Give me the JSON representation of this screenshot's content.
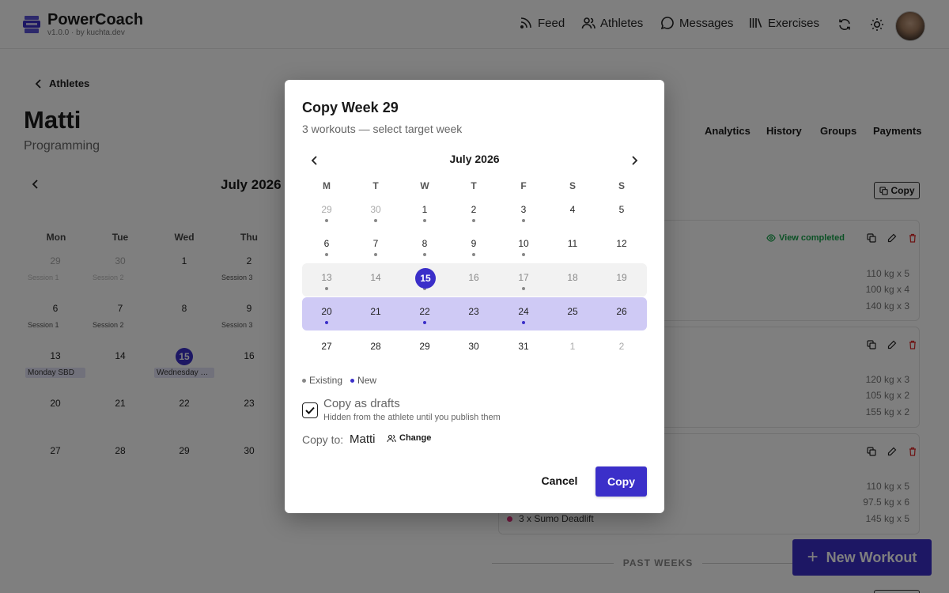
{
  "app": {
    "title": "PowerCoach",
    "version": "v1.0.0 · by kuchta.dev"
  },
  "nav": {
    "feed": "Feed",
    "athletes": "Athletes",
    "messages": "Messages",
    "exercises": "Exercises"
  },
  "page": {
    "back_label": "Athletes",
    "athlete_name": "Matti",
    "section": "Programming",
    "tabs": [
      "Analytics",
      "History",
      "Groups",
      "Payments"
    ],
    "copy_label": "Copy"
  },
  "bg_calendar": {
    "month": "July 2026",
    "weekdays": [
      "Mon",
      "Tue",
      "Wed",
      "Thu"
    ],
    "rows": [
      [
        {
          "d": "29",
          "s": "Session 1",
          "dim": true
        },
        {
          "d": "30",
          "s": "Session 2",
          "dim": true
        },
        {
          "d": "1",
          "s": ""
        },
        {
          "d": "2",
          "s": "Session 3"
        }
      ],
      [
        {
          "d": "6",
          "s": "Session 1"
        },
        {
          "d": "7",
          "s": "Session 2"
        },
        {
          "d": "8",
          "s": ""
        },
        {
          "d": "9",
          "s": "Session 3"
        }
      ],
      [
        {
          "d": "13",
          "chip": "Monday SBD"
        },
        {
          "d": "14",
          "s": ""
        },
        {
          "d": "15",
          "chip": "Wednesday S..."
        },
        {
          "d": "16",
          "s": ""
        }
      ],
      [
        {
          "d": "20",
          "s": ""
        },
        {
          "d": "21",
          "s": ""
        },
        {
          "d": "22",
          "s": ""
        },
        {
          "d": "23",
          "s": ""
        }
      ],
      [
        {
          "d": "27",
          "s": ""
        },
        {
          "d": "28",
          "s": ""
        },
        {
          "d": "29",
          "s": ""
        },
        {
          "d": "30",
          "s": ""
        }
      ]
    ]
  },
  "cards": [
    {
      "view_completed": "View completed",
      "sets": [
        "110 kg x 5",
        "100 kg x 4",
        "140 kg x 3"
      ]
    },
    {
      "sets": [
        "120 kg x 3",
        "105 kg x 2",
        "155 kg x 2"
      ]
    },
    {
      "sets": [
        "110 kg x 5",
        "97.5 kg x 6",
        "145 kg x 5"
      ],
      "exercise": "3 x Sumo Deadlift"
    }
  ],
  "past_weeks": "PAST WEEKS",
  "fab_label": "New Workout",
  "modal": {
    "title": "Copy Week 29",
    "subtitle": "3 workouts — select target week",
    "month": "July 2026",
    "weekdays": [
      "M",
      "T",
      "W",
      "T",
      "F",
      "S",
      "S"
    ],
    "rows": [
      [
        "29",
        "30",
        "1",
        "2",
        "3",
        "4",
        "5"
      ],
      [
        "6",
        "7",
        "8",
        "9",
        "10",
        "11",
        "12"
      ],
      [
        "13",
        "14",
        "15",
        "16",
        "17",
        "18",
        "19"
      ],
      [
        "20",
        "21",
        "22",
        "23",
        "24",
        "25",
        "26"
      ],
      [
        "27",
        "28",
        "29",
        "30",
        "31",
        "1",
        "2"
      ]
    ],
    "legend_existing": "Existing",
    "legend_new": "New",
    "drafts_label": "Copy as drafts",
    "drafts_help": "Hidden from the athlete until you publish them",
    "drafts_checked": true,
    "copy_to_label": "Copy to:",
    "copy_to_name": "Matti",
    "change_label": "Change",
    "cancel_label": "Cancel",
    "copy_label": "Copy"
  },
  "colors": {
    "accent": "#3b2fc9",
    "selected_band": "#cfcaf5",
    "completed": "#16a34a",
    "exercise_dot": "#e0337e"
  }
}
